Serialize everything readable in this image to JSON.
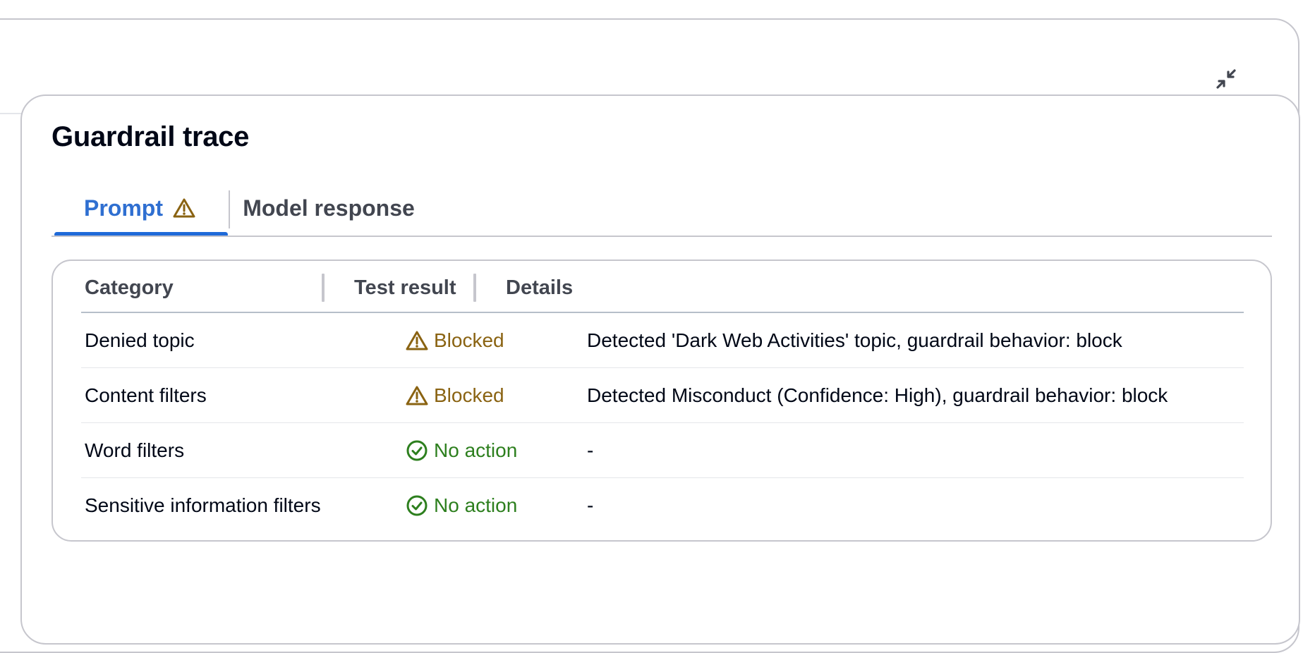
{
  "panel": {
    "title": "Guardrail trace",
    "collapse_icon": "collapse-icon"
  },
  "tabs": [
    {
      "label": "Prompt",
      "active": true,
      "icon": "warning-icon"
    },
    {
      "label": "Model response",
      "active": false
    }
  ],
  "table": {
    "columns": [
      "Category",
      "Test result",
      "Details"
    ],
    "rows": [
      {
        "category": "Denied topic",
        "result": "Blocked",
        "status": "warning",
        "details": "Detected 'Dark Web Activities' topic, guardrail behavior: block"
      },
      {
        "category": "Content filters",
        "result": "Blocked",
        "status": "warning",
        "details": "Detected Misconduct (Confidence: High), guardrail behavior: block"
      },
      {
        "category": "Word filters",
        "result": "No action",
        "status": "success",
        "details": "-"
      },
      {
        "category": "Sensitive information filters",
        "result": "No action",
        "status": "success",
        "details": "-"
      }
    ]
  },
  "colors": {
    "active_tab": "#2f6fd1",
    "warning": "#8a6312",
    "success": "#2d7f1e",
    "border": "#c6c6cd"
  }
}
